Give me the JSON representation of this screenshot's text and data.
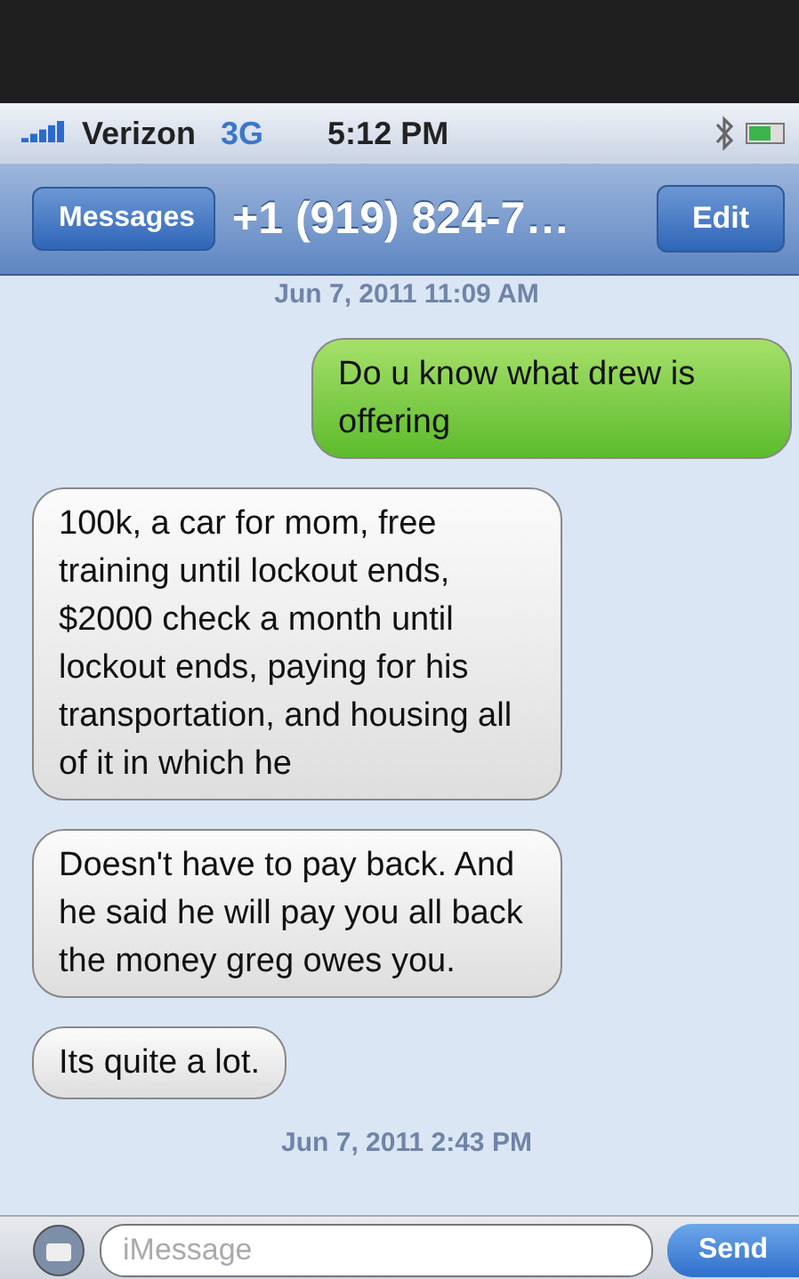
{
  "status_bar": {
    "carrier": "Verizon",
    "network": "3G",
    "time": "5:12 PM"
  },
  "nav_bar": {
    "back": "Messages",
    "title": "+1 (919) 824-7…",
    "action": "Edit"
  },
  "messages": [
    {
      "kind": "timestamp",
      "text": "Jun 7, 2011 11:09 AM"
    },
    {
      "kind": "sent",
      "text": "Do u know what drew is offering"
    },
    {
      "kind": "received",
      "text": "100k, a car for mom, free training until lockout ends, $2000 check a month until lockout ends, paying for his transportation, and housing all of it in which he"
    },
    {
      "kind": "received",
      "text": "Doesn't have to pay back. And he said he will pay you all back the money greg owes you."
    },
    {
      "kind": "received",
      "text": "Its quite a lot."
    },
    {
      "kind": "timestamp",
      "text": "Jun 7, 2011 2:43 PM"
    }
  ],
  "composer": {
    "placeholder": "iMessage",
    "send": "Send"
  }
}
